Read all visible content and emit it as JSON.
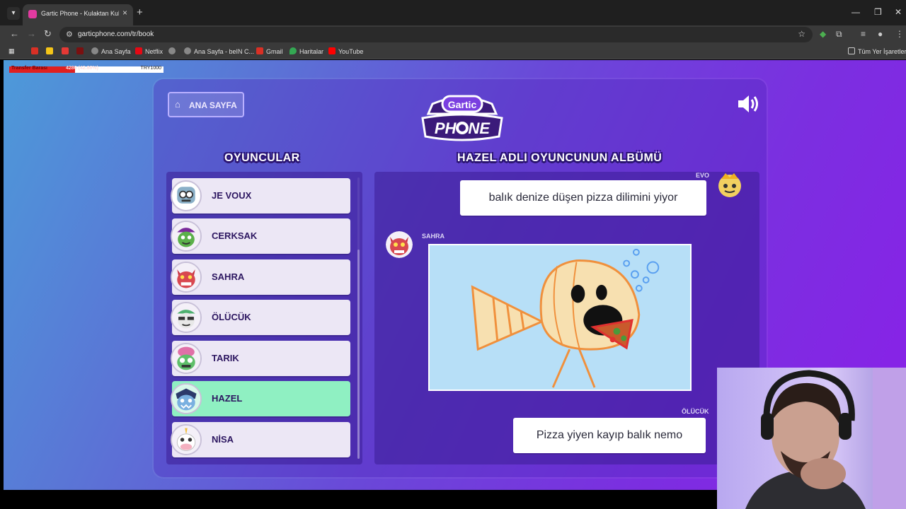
{
  "browser": {
    "tab_title": "Gartic Phone - Kulaktan Kulağa",
    "url": "garticphone.com/tr/book",
    "bookmarks": [
      "Ana Sayfa",
      "Netflix",
      "Ana Sayfa - beIN C...",
      "Gmail",
      "Haritalar",
      "YouTube"
    ],
    "all_bookmarks": "Tüm Yer İşaretleri"
  },
  "overlay": {
    "label": "Transfer Barası",
    "progress": "4286 (42.86%)",
    "goal": "TRY1000",
    "progress_fraction": 0.4286
  },
  "game": {
    "home_label": "ANA SAYFA",
    "logo_top": "Gartic",
    "logo_bottom": "PHONE",
    "players_heading": "OYUNCULAR",
    "album_heading": "HAZEL ADLI OYUNCUNUN ALBÜMÜ",
    "players": [
      {
        "name": "JE VOUX",
        "active": false
      },
      {
        "name": "CERKSAK",
        "active": false
      },
      {
        "name": "SAHRA",
        "active": false
      },
      {
        "name": "ÖLÜCÜK",
        "active": false
      },
      {
        "name": "TARIK",
        "active": false
      },
      {
        "name": "HAZEL",
        "active": true
      },
      {
        "name": "NİSA",
        "active": false
      }
    ],
    "album": {
      "top_author": "EVO",
      "top_text": "balık denize düşen pizza dilimini yiyor",
      "drawing_author": "SAHRA",
      "bottom_author": "ÖLÜCÜK",
      "bottom_text": "Pizza yiyen kayıp balık nemo"
    }
  },
  "colors": {
    "active_row": "#8ff0c2",
    "row": "#ece7f5",
    "heading_text": "#ffffff"
  }
}
